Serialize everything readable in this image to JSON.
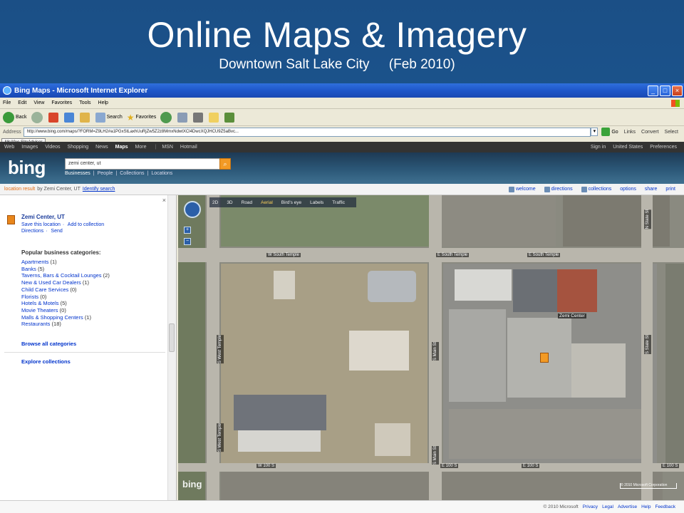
{
  "slide": {
    "title": "Online Maps & Imagery",
    "subtitle_place": "Downtown Salt Lake City",
    "subtitle_date": "(Feb 2010)"
  },
  "browser": {
    "window_title": "Bing Maps - Microsoft Internet Explorer",
    "menu": [
      "File",
      "Edit",
      "View",
      "Favorites",
      "Tools",
      "Help"
    ],
    "toolbar": {
      "back": "Back",
      "search": "Search",
      "favorites": "Favorites"
    },
    "address_label": "Address",
    "address_url": "http://www.bing.com/maps/?FORM=Z9LH2#a1PGxStLaxhUuRjZw5Z2z8MmxNdwtXCl4DwcXQJHCU9Z5aBvc...",
    "go_label": "Go",
    "links_label": "Links",
    "convert_label": "Convert",
    "select_label": "Select",
    "mcafee_label": "McAfee SiteAdvisor"
  },
  "bing": {
    "topnav": [
      "Web",
      "Images",
      "Videos",
      "Shopping",
      "News",
      "Maps",
      "More"
    ],
    "topnav_active": "Maps",
    "topnav_extra": [
      "MSN",
      "Hotmail"
    ],
    "topnav_right": [
      "Sign in",
      "United States",
      "Preferences"
    ],
    "logo": "bing",
    "search_value": "zemi center, ut",
    "search_button_glyph": "⌕",
    "scopes": [
      "Businesses",
      "People",
      "Collections",
      "Locations"
    ],
    "scopes_separator": "|",
    "result_label": "location result",
    "result_by": "by Zemi Center, UT",
    "identify_link": "Identify search",
    "actions": [
      "welcome",
      "directions",
      "collections",
      "options",
      "share",
      "print"
    ],
    "close_glyph": "×"
  },
  "result": {
    "name": "Zemi Center, UT",
    "links_row1": [
      "Save this location",
      "Add to collection"
    ],
    "links_row2": [
      "Directions",
      "Send"
    ],
    "link_separator": "·"
  },
  "categories": {
    "heading": "Popular business categories:",
    "items": [
      {
        "name": "Apartments",
        "count": "(1)"
      },
      {
        "name": "Banks",
        "count": "(5)"
      },
      {
        "name": "Taverns, Bars & Cocktail Lounges",
        "count": "(2)"
      },
      {
        "name": "New & Used Car Dealers",
        "count": "(1)"
      },
      {
        "name": "Child Care Services",
        "count": "(0)"
      },
      {
        "name": "Florists",
        "count": "(0)"
      },
      {
        "name": "Hotels & Motels",
        "count": "(5)"
      },
      {
        "name": "Movie Theaters",
        "count": "(0)"
      },
      {
        "name": "Malls & Shopping Centers",
        "count": "(1)"
      },
      {
        "name": "Restaurants",
        "count": "(18)"
      }
    ],
    "browse_all": "Browse all categories",
    "explore": "Explore collections"
  },
  "map": {
    "modes": [
      "Road",
      "Aerial",
      "Bird's eye",
      "Labels",
      "Traffic"
    ],
    "active_mode": "Aerial",
    "mode_3d": "3D",
    "mode_2d": "2D",
    "zoom_in": "+",
    "zoom_out": "−",
    "streets": {
      "w_south_temple": "W South Temple",
      "e_south_temple": "E South Temple",
      "e_south_temple_right": "E South Temple",
      "w_100_s": "W 100 S",
      "e_100_s": "E 100 S",
      "e_100_s_2": "E 100 S",
      "e_100_s_right": "E 100 S",
      "s_west_temple": "S West Temple",
      "s_west_temple_2": "S West Temple",
      "s_main_st": "S Main St",
      "s_main_st_2": "S Main St",
      "s_state_st": "S State St",
      "n_state_st": "N State St"
    },
    "place_label": "Zemi Center",
    "watermark": "bing",
    "copyright": "© 2010 Microsoft Corporation"
  },
  "status": {
    "copyright": "© 2010 Microsoft",
    "links": [
      "Privacy",
      "Legal",
      "Advertise",
      "Help",
      "Feedback"
    ]
  },
  "colors": {
    "slide_bg": "#1c5a98",
    "bing_orange": "#f29a25",
    "link_blue": "#0033cc",
    "location_orange": "#e36b12"
  }
}
